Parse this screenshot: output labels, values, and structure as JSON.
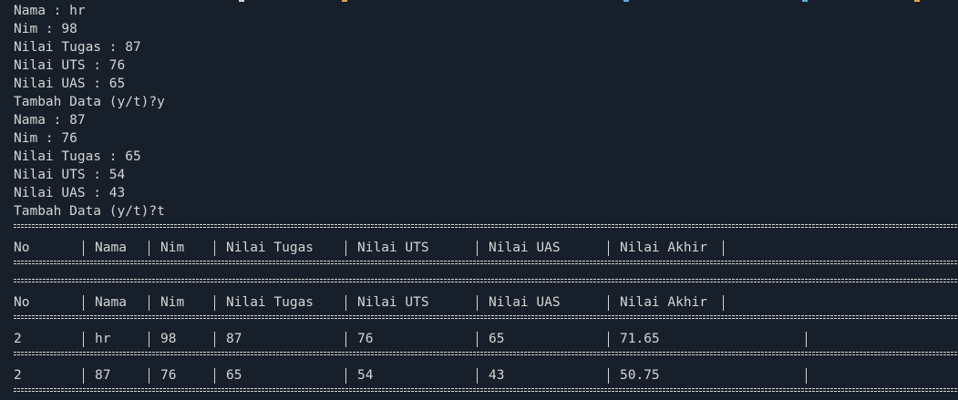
{
  "colors": {
    "background": "#17202a",
    "text": "#d4d4d4",
    "accent_orange": "#e2a43a",
    "accent_blue": "#4fb0e8"
  },
  "input_lines": [
    "Nama : hr",
    "Nim : 98",
    "Nilai Tugas : 87",
    "Nilai UTS : 76",
    "Nilai UAS : 65",
    "Tambah Data (y/t)?y",
    "Nama : 87",
    "Nim : 76",
    "Nilai Tugas : 65",
    "Nilai UTS : 54",
    "Nilai UAS : 43",
    "Tambah Data (y/t)?t"
  ],
  "table": {
    "headers": [
      "No",
      "Nama",
      "Nim",
      "Nilai Tugas",
      "Nilai UTS",
      "Nilai UAS",
      "Nilai Akhir"
    ],
    "rows": [
      [
        "2",
        "hr",
        "98",
        "87",
        "76",
        "65",
        "71.65"
      ],
      [
        "2",
        "87",
        "76",
        "65",
        "54",
        "43",
        "50.75"
      ]
    ]
  }
}
